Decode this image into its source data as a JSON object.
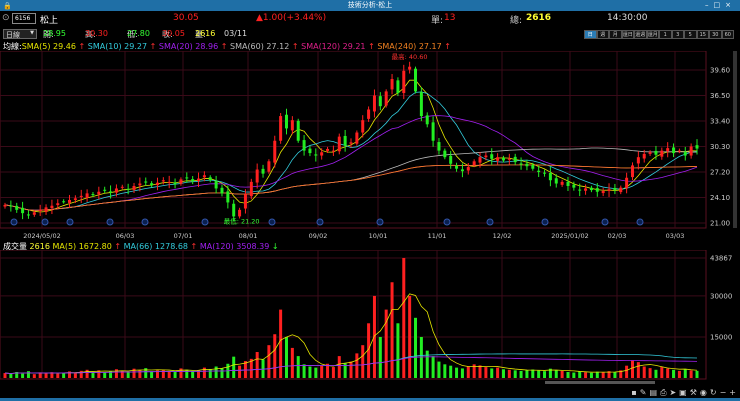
{
  "window": {
    "title": "技術分析-松上",
    "lock_icon": "lock-icon"
  },
  "quote": {
    "code": "6156",
    "name": "松上",
    "price": "30.05",
    "change": "▲1.00(+3.44%)",
    "single_label": "單:",
    "single": "13",
    "total_label": "總:",
    "total": "2616",
    "time": "14:30:00"
  },
  "ohlc": {
    "period": "日線",
    "open_label": "開:",
    "open": "28.95",
    "high_label": "高:",
    "high": "30.30",
    "low_label": "低:",
    "low": "27.80",
    "close_label": "收:",
    "close": "30.05",
    "vol_label": "量:",
    "vol": "2616",
    "date": "03/11"
  },
  "periods": [
    "日",
    "週",
    "月",
    "還日",
    "還週",
    "還月",
    "1",
    "3",
    "5",
    "15",
    "30",
    "60"
  ],
  "sma_legend": {
    "label": "均線:",
    "items": [
      {
        "text": "SMA(5) 29.46",
        "color": "#e6e600"
      },
      {
        "text": "SMA(10) 29.27",
        "color": "#33ccdd"
      },
      {
        "text": "SMA(20) 28.96",
        "color": "#a020f0"
      },
      {
        "text": "SMA(60) 27.12",
        "color": "#bbbbbb"
      },
      {
        "text": "SMA(120) 29.21",
        "color": "#e0208a"
      },
      {
        "text": "SMA(240) 27.17",
        "color": "#f08020"
      }
    ]
  },
  "vol_legend": {
    "label": "成交量",
    "value": "2616",
    "items": [
      {
        "text": "MA(5) 1672.80",
        "color": "#e6e600",
        "arrow": "↑"
      },
      {
        "text": "MA(66) 1278.68",
        "color": "#33ccdd",
        "arrow": "↑"
      },
      {
        "text": "MA(120) 3508.39",
        "color": "#a020f0",
        "arrow": "↓"
      }
    ]
  },
  "chart_data": {
    "type": "candlestick",
    "price_ticks": [
      "39.60",
      "36.50",
      "33.40",
      "30.30",
      "27.20",
      "24.10",
      "21.00"
    ],
    "ylim": [
      21.0,
      41.0
    ],
    "vol_ticks": [
      "43867",
      "30000",
      "15000"
    ],
    "x_labels": [
      "2024/05/02",
      "06/03",
      "07/01",
      "08/01",
      "09/02",
      "10/01",
      "11/01",
      "12/02",
      "2025/01/02",
      "02/03",
      "03/03"
    ],
    "high_annotation": "最高: 40.60",
    "low_annotation": "最低: 21.20",
    "closes": [
      23.2,
      23.0,
      22.6,
      22.2,
      22.0,
      22.3,
      22.6,
      22.9,
      23.1,
      23.4,
      23.6,
      23.8,
      24.0,
      24.3,
      24.6,
      24.4,
      24.8,
      25.0,
      24.7,
      25.2,
      25.4,
      25.1,
      25.5,
      25.8,
      26.0,
      25.6,
      25.9,
      26.2,
      26.0,
      25.7,
      26.3,
      26.5,
      26.1,
      26.4,
      26.8,
      26.2,
      25.2,
      24.6,
      23.5,
      21.8,
      22.6,
      24.5,
      26.0,
      27.5,
      27.0,
      28.5,
      31.0,
      34.0,
      32.5,
      33.5,
      31.0,
      29.8,
      29.5,
      29.2,
      29.6,
      30.0,
      29.8,
      31.5,
      30.4,
      30.8,
      32.0,
      33.5,
      34.8,
      36.5,
      35.2,
      37.0,
      38.5,
      36.8,
      39.5,
      40.0,
      37.0,
      34.0,
      33.0,
      31.0,
      29.8,
      29.0,
      28.2,
      27.6,
      27.3,
      27.8,
      28.5,
      29.0,
      29.2,
      28.8,
      29.0,
      28.6,
      28.8,
      28.4,
      28.2,
      27.9,
      27.6,
      27.2,
      27.0,
      26.2,
      25.8,
      26.0,
      25.5,
      25.3,
      25.0,
      25.2,
      25.0,
      24.8,
      24.9,
      25.1,
      25.0,
      25.3,
      26.5,
      28.0,
      29.0,
      29.4,
      29.6,
      29.3,
      29.8,
      30.1,
      29.5,
      29.8,
      29.2,
      30.3,
      30.05
    ],
    "volumes": [
      1800,
      1500,
      2200,
      1600,
      2500,
      1400,
      1900,
      1700,
      2100,
      1600,
      2000,
      2400,
      1800,
      2600,
      3000,
      2200,
      2800,
      2100,
      2500,
      3200,
      2700,
      2300,
      3400,
      2900,
      3600,
      2400,
      2800,
      3100,
      2600,
      2300,
      3500,
      3000,
      2500,
      2900,
      3800,
      3300,
      4200,
      3600,
      5200,
      7800,
      4500,
      6200,
      7000,
      9500,
      6800,
      12000,
      16000,
      25000,
      15000,
      11000,
      8000,
      5000,
      4200,
      3800,
      4500,
      5200,
      4000,
      8000,
      5500,
      6000,
      9000,
      12000,
      20000,
      30000,
      15000,
      25000,
      35000,
      20000,
      43867,
      30000,
      22000,
      15000,
      10000,
      8000,
      6000,
      5000,
      4500,
      3800,
      3500,
      4200,
      5000,
      4600,
      4000,
      3500,
      3800,
      3200,
      3000,
      2800,
      2600,
      2900,
      3100,
      2700,
      2500,
      3400,
      2800,
      2600,
      2200,
      2000,
      2400,
      2100,
      1900,
      2300,
      2000,
      2500,
      2200,
      2800,
      4500,
      6500,
      5800,
      4200,
      3600,
      3000,
      4000,
      3500,
      3000,
      2600,
      3200,
      2800,
      2616
    ]
  },
  "toolbar": [
    "hide",
    "pen",
    "window",
    "print",
    "cursor",
    "crop",
    "tools",
    "eye",
    "reset",
    "zoom-out",
    "zoom-in"
  ]
}
